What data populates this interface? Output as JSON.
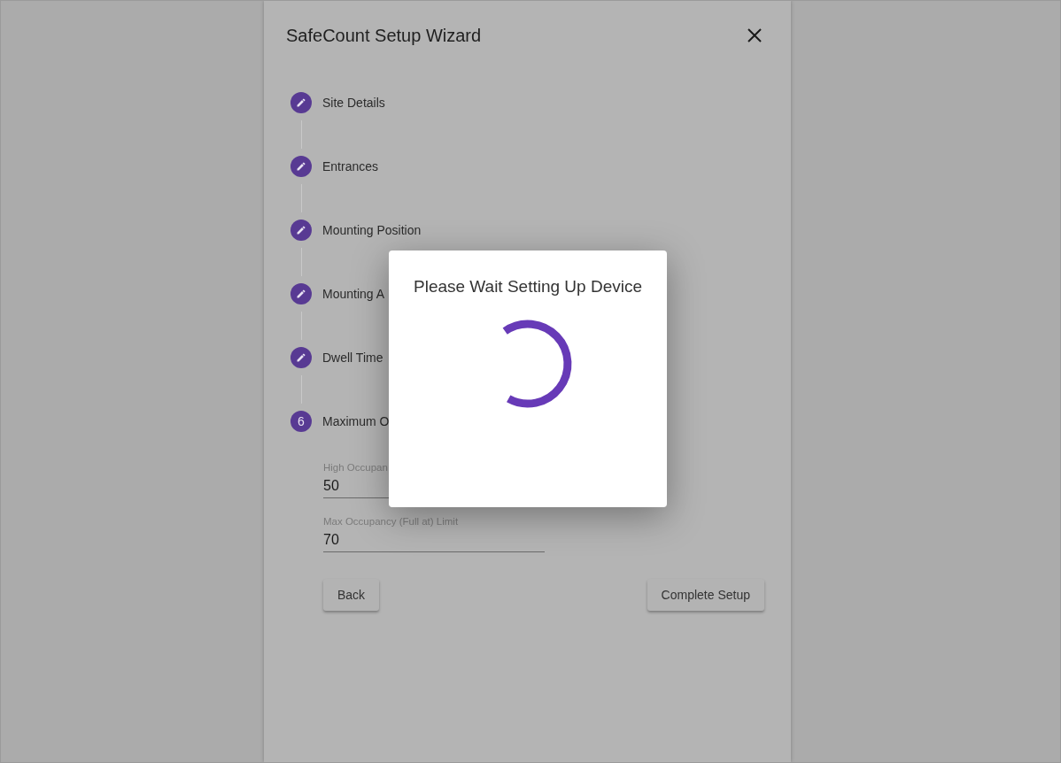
{
  "wizard": {
    "title": "SafeCount Setup Wizard",
    "steps": [
      {
        "kind": "edit",
        "label": "Site Details"
      },
      {
        "kind": "edit",
        "label": "Entrances"
      },
      {
        "kind": "edit",
        "label": "Mounting Position"
      },
      {
        "kind": "edit",
        "label": "Mounting A"
      },
      {
        "kind": "edit",
        "label": "Dwell Time"
      },
      {
        "kind": "number",
        "number": "6",
        "label": "Maximum O"
      }
    ],
    "fields": [
      {
        "label": "High Occupan",
        "value": "50"
      },
      {
        "label": "Max Occupancy (Full at) Limit",
        "value": "70"
      }
    ],
    "buttons": {
      "back": "Back",
      "complete": "Complete Setup"
    }
  },
  "dialog": {
    "title": "Please Wait Setting Up Device"
  }
}
